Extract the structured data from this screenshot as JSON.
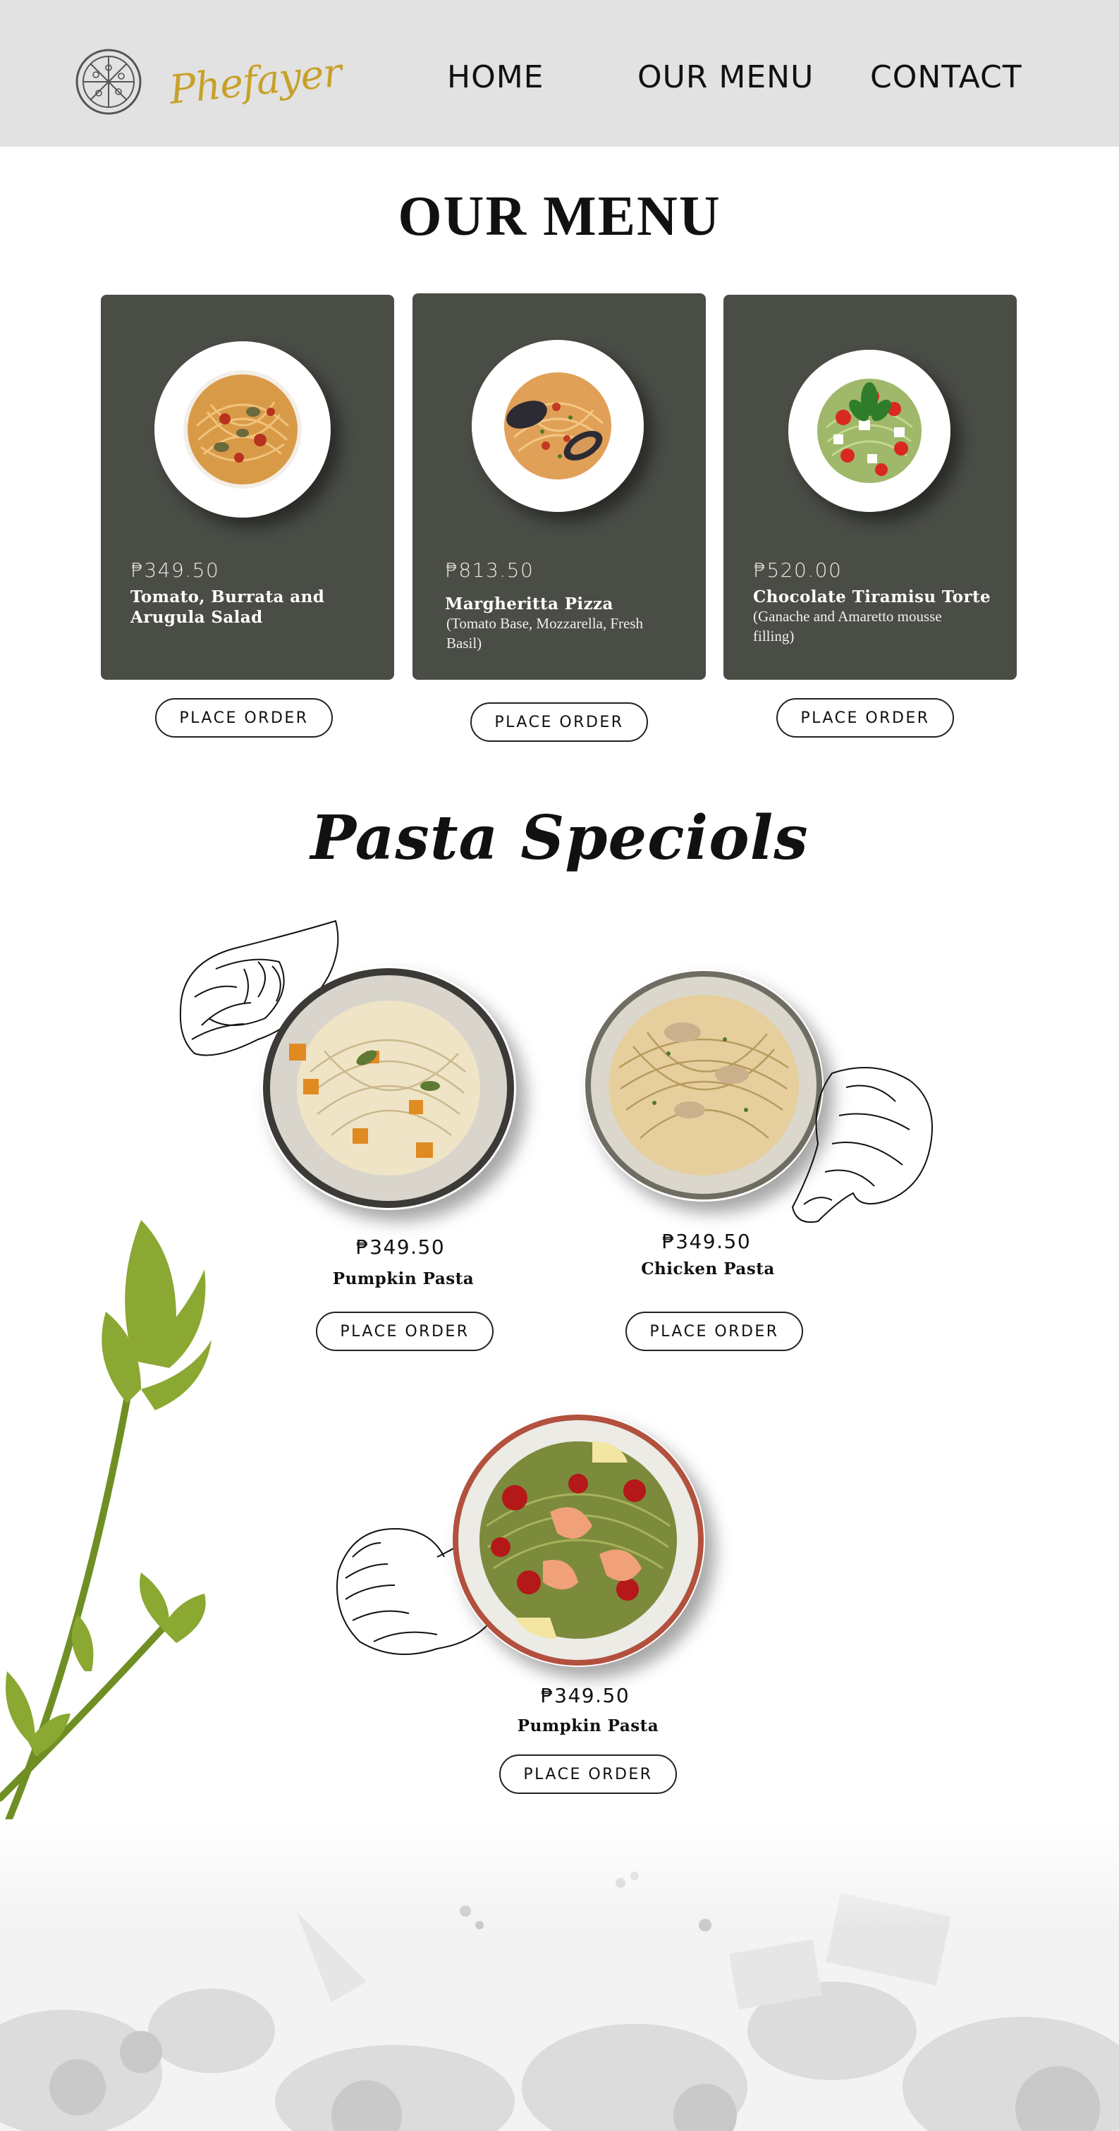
{
  "header": {
    "brand": "Phefayer",
    "nav": [
      {
        "label": "HOME"
      },
      {
        "label": "OUR MENU"
      },
      {
        "label": "CONTACT"
      }
    ]
  },
  "menu": {
    "title": "OUR MENU",
    "items": [
      {
        "price": "₱349.50",
        "name": "Tomato, Burrata and Arugula Salad",
        "desc": "",
        "button": "PLACE ORDER"
      },
      {
        "price": "₱813.50",
        "name": "Margheritta Pizza",
        "desc": "(Tomato Base, Mozzarella, Fresh Basil)",
        "button": "PLACE ORDER"
      },
      {
        "price": "₱520.00",
        "name": "Chocolate Tiramisu Torte",
        "desc": "(Ganache and Amaretto mousse filling)",
        "button": "PLACE ORDER"
      }
    ]
  },
  "specials": {
    "title": "Pasta Speciols",
    "items": [
      {
        "price": "₱349.50",
        "name": "Pumpkin Pasta",
        "button": "PLACE ORDER"
      },
      {
        "price": "₱349.50",
        "name": "Chicken Pasta",
        "button": "PLACE ORDER"
      },
      {
        "price": "₱349.50",
        "name": "Pumpkin Pasta",
        "button": "PLACE ORDER"
      }
    ]
  },
  "colors": {
    "header_bg": "#e2e2e2",
    "card_bg": "#4a4d46",
    "brand_gold": "#c8a12a",
    "celery_green": "#8aa832"
  },
  "icons": {
    "logo": "pizza-emblem-icon"
  }
}
